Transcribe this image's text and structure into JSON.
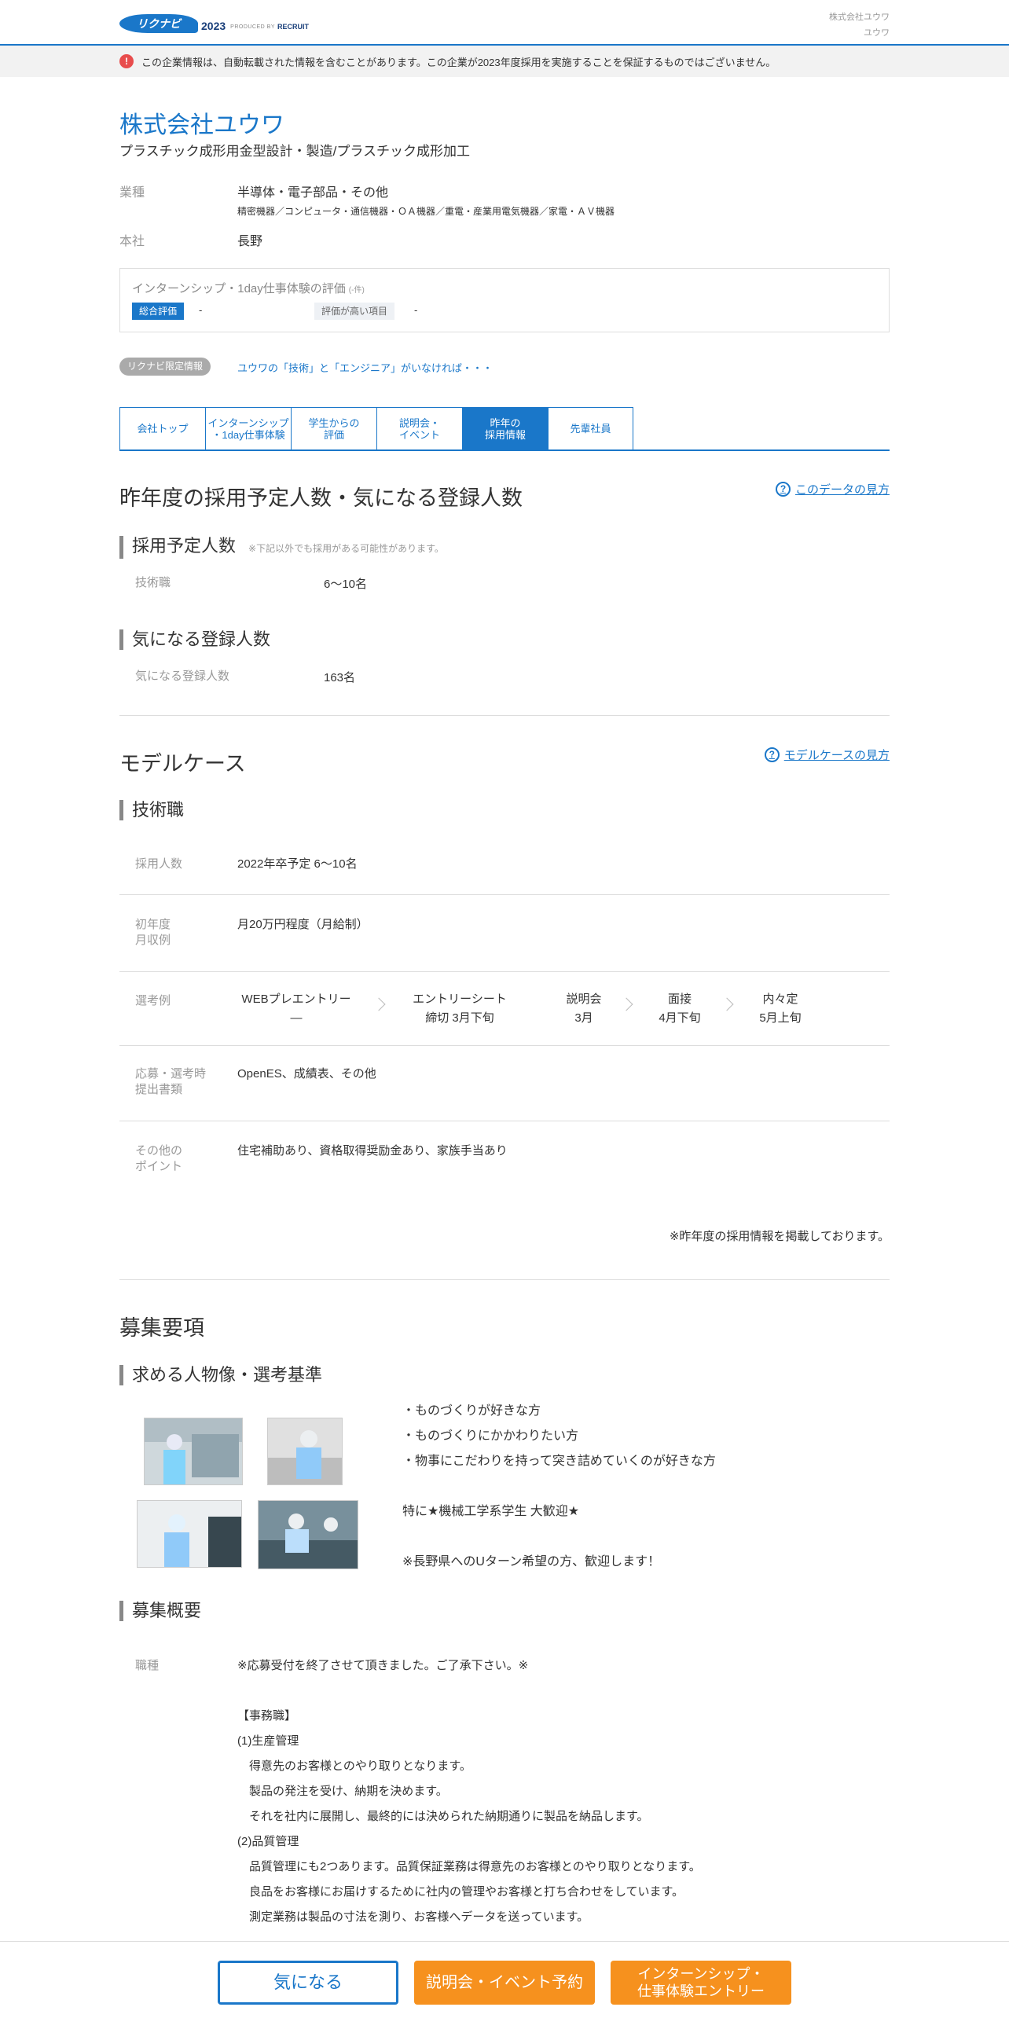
{
  "header": {
    "logo_text": "リクナビ",
    "logo_year": "2023",
    "logo_produced_by": "PRODUCED BY",
    "logo_recruit": "RECRUIT",
    "company_short_1": "株式会社ユウワ",
    "company_short_2": "ユウワ"
  },
  "notice": {
    "icon": "!",
    "text": "この企業情報は、自動転載された情報を含むことがあります。この企業が2023年度採用を実施することを保証するものではございません。"
  },
  "company": {
    "name": "株式会社ユウワ",
    "subtitle": "プラスチック成形用金型設計・製造/プラスチック成形加工",
    "industry_label": "業種",
    "industry_value": "半導体・電子部品・その他",
    "industry_detail": "精密機器／コンピュータ・通信機器・ＯＡ機器／重電・産業用電気機器／家電・ＡＶ機器",
    "hq_label": "本社",
    "hq_value": "長野"
  },
  "rating": {
    "title": "インターンシップ・1day仕事体験の評価",
    "count": "(-件)",
    "overall_label": "総合評価",
    "overall_value": "-",
    "high_label": "評価が高い項目",
    "high_value": "-"
  },
  "promo": {
    "badge": "リクナビ限定情報",
    "link": "ユウワの「技術」と「エンジニア」がいなければ・・・"
  },
  "tabs": [
    {
      "label": "会社トップ",
      "active": false
    },
    {
      "label": "インターンシップ\n・1day仕事体験",
      "active": false
    },
    {
      "label": "学生からの\n評価",
      "active": false
    },
    {
      "label": "説明会・\nイベント",
      "active": false
    },
    {
      "label": "昨年の\n採用情報",
      "active": true
    },
    {
      "label": "先輩社員",
      "active": false
    }
  ],
  "planned": {
    "heading": "昨年度の採用予定人数・気になる登録人数",
    "help": "このデータの見方",
    "sub1": "採用予定人数",
    "sub1_note": "※下記以外でも採用がある可能性があります。",
    "tech_label": "技術職",
    "tech_value": "6～10名",
    "sub2": "気になる登録人数",
    "reg_label": "気になる登録人数",
    "reg_value": "163名"
  },
  "model": {
    "heading": "モデルケース",
    "help": "モデルケースの見方",
    "sub": "技術職",
    "hires_label": "採用人数",
    "hires_value": "2022年卒予定 6～10名",
    "salary_label": "初年度\n月収例",
    "salary_value": "月20万円程度（月給制）",
    "selection_label": "選考例",
    "steps": [
      "WEBプレエントリー\n―",
      "エントリーシート\n締切 3月下旬",
      "説明会\n3月",
      "面接\n4月下旬",
      "内々定\n5月上旬"
    ],
    "docs_label": "応募・選考時\n提出書類",
    "docs_value": "OpenES、成績表、その他",
    "points_label": "その他の\nポイント",
    "points_value": "住宅補助あり、資格取得奨励金あり、家族手当あり",
    "footnote": "※昨年度の採用情報を掲載しております。"
  },
  "recruit": {
    "heading": "募集要項",
    "sub1": "求める人物像・選考基準",
    "bullets": [
      "・ものづくりが好きな方",
      "・ものづくりにかかわりたい方",
      "・物事にこだわりを持って突き詰めていくのが好きな方",
      "",
      "特に★機械工学系学生 大歓迎★",
      "",
      "※長野県へのUターン希望の方、歓迎します！"
    ],
    "sub2": "募集概要",
    "job_label": "職種",
    "job_lines": [
      "※応募受付を終了させて頂きました。ご了承下さい。※",
      "",
      "【事務職】",
      "(1)生産管理",
      "　得意先のお客様とのやり取りとなります。",
      "　製品の発注を受け、納期を決めます。",
      "　それを社内に展開し、最終的には決められた納期通りに製品を納品します。",
      "(2)品質管理",
      "　品質管理にも2つあります。品質保証業務は得意先のお客様とのやり取りとなります。",
      "　良品をお客様にお届けするために社内の管理やお客様と打ち合わせをしています。",
      "　測定業務は製品の寸法を測り、お客様へデータを送っています。"
    ]
  },
  "bottom": {
    "fav": "気になる",
    "seminar": "説明会・イベント予約",
    "intern": "インターンシップ・\n仕事体験エントリー"
  },
  "colors": {
    "brand": "#1a77c9",
    "cta": "#f6911e",
    "alert": "#e84c4c"
  }
}
